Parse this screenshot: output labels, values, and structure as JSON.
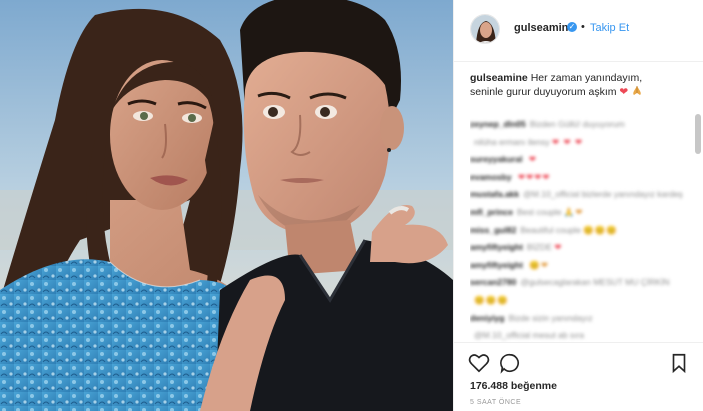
{
  "post": {
    "username": "gulseamine",
    "separator": "•",
    "follow_label": "Takip Et",
    "verified_glyph": "✓",
    "caption_text": "Her zaman yanındayım, seninle gurur duyuyorum aşkım",
    "caption_hearts": "❤",
    "likes_text": "176.488 beğenme",
    "time_text": "5 SAAT ÖNCE"
  },
  "comments": [
    {
      "user": "zeynep_dln05",
      "text": "Bizden Güllü! duyuyorum",
      "emoji": ""
    },
    {
      "user": "",
      "text": "nilüha ermanı ilensy",
      "emoji": "❤ ❤ ❤"
    },
    {
      "user": "sureyyakural",
      "text": "",
      "emoji": "❤"
    },
    {
      "user": "evamosby",
      "text": "",
      "emoji": "❤❤❤❤"
    },
    {
      "user": "mustafa.akk",
      "text": "@M.10_official bizlerde yanındayız kardeş",
      "emoji": ""
    },
    {
      "user": "mfl_prince",
      "text": "Best couple",
      "emoji": "🙏❤"
    },
    {
      "user": "miss_gul82",
      "text": "Beautiful couple",
      "emoji": "😊😊😊"
    },
    {
      "user": "amyfiftyeight",
      "text": "BİZDE",
      "emoji": "❤"
    },
    {
      "user": "amyfiftyeight",
      "text": "",
      "emoji": "😊❤"
    },
    {
      "user": "sercan2780",
      "text": "@gulsecaglarakan MESUT MU ÇİRKİN",
      "emoji": ""
    },
    {
      "user": "",
      "text": "",
      "emoji": "😊😊😊"
    },
    {
      "user": "deniyiyg",
      "text": "Bizde sizin yanındayız",
      "emoji": ""
    },
    {
      "user": "",
      "text": "@M.10_official mesut ab sıra",
      "emoji": ""
    }
  ],
  "icons": {
    "like": "heart-outline-icon",
    "comment": "speech-bubble-icon",
    "save": "bookmark-icon",
    "verified": "verified-badge-icon"
  },
  "colors": {
    "accent": "#3897f0",
    "heart": "#ed4956",
    "text": "#262626",
    "muted": "#8e8e8e"
  }
}
